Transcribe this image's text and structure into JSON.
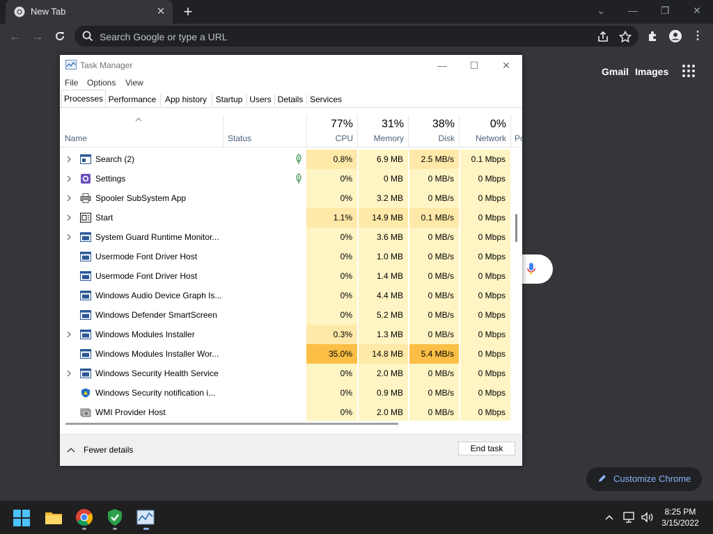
{
  "chrome": {
    "tab_title": "New Tab",
    "omnibox_placeholder": "Search Google or type a URL",
    "links": {
      "gmail": "Gmail",
      "images": "Images"
    },
    "customize_label": "Customize Chrome"
  },
  "taskmanager": {
    "title": "Task Manager",
    "menu": [
      "File",
      "Options",
      "View"
    ],
    "tabs": [
      "Processes",
      "Performance",
      "App history",
      "Startup",
      "Users",
      "Details",
      "Services"
    ],
    "active_tab": "Processes",
    "columns": {
      "name": "Name",
      "status": "Status",
      "cpu": {
        "pct": "77%",
        "label": "CPU"
      },
      "memory": {
        "pct": "31%",
        "label": "Memory"
      },
      "disk": {
        "pct": "38%",
        "label": "Disk"
      },
      "network": {
        "pct": "0%",
        "label": "Network"
      },
      "power_partial": "Po"
    },
    "rows": [
      {
        "name": "Search (2)",
        "expandable": true,
        "icon": "search-app-icon",
        "eco": true,
        "cpu": "0.8%",
        "memory": "6.9 MB",
        "disk": "2.5 MB/s",
        "network": "0.1 Mbps"
      },
      {
        "name": "Settings",
        "expandable": true,
        "icon": "settings-gear-icon",
        "eco": true,
        "cpu": "0%",
        "memory": "0 MB",
        "disk": "0 MB/s",
        "network": "0 Mbps"
      },
      {
        "name": "Spooler SubSystem App",
        "expandable": true,
        "icon": "printer-icon",
        "eco": false,
        "cpu": "0%",
        "memory": "3.2 MB",
        "disk": "0 MB/s",
        "network": "0 Mbps"
      },
      {
        "name": "Start",
        "expandable": true,
        "icon": "start-icon",
        "eco": false,
        "cpu": "1.1%",
        "memory": "14.9 MB",
        "disk": "0.1 MB/s",
        "network": "0 Mbps"
      },
      {
        "name": "System Guard Runtime Monitor...",
        "expandable": true,
        "icon": "process-window-icon",
        "eco": false,
        "cpu": "0%",
        "memory": "3.6 MB",
        "disk": "0 MB/s",
        "network": "0 Mbps"
      },
      {
        "name": "Usermode Font Driver Host",
        "expandable": false,
        "icon": "process-window-icon",
        "eco": false,
        "cpu": "0%",
        "memory": "1.0 MB",
        "disk": "0 MB/s",
        "network": "0 Mbps"
      },
      {
        "name": "Usermode Font Driver Host",
        "expandable": false,
        "icon": "process-window-icon",
        "eco": false,
        "cpu": "0%",
        "memory": "1.4 MB",
        "disk": "0 MB/s",
        "network": "0 Mbps"
      },
      {
        "name": "Windows Audio Device Graph Is...",
        "expandable": false,
        "icon": "process-window-icon",
        "eco": false,
        "cpu": "0%",
        "memory": "4.4 MB",
        "disk": "0 MB/s",
        "network": "0 Mbps"
      },
      {
        "name": "Windows Defender SmartScreen",
        "expandable": false,
        "icon": "process-window-icon",
        "eco": false,
        "cpu": "0%",
        "memory": "5.2 MB",
        "disk": "0 MB/s",
        "network": "0 Mbps"
      },
      {
        "name": "Windows Modules Installer",
        "expandable": true,
        "icon": "process-window-icon",
        "eco": false,
        "cpu": "0.3%",
        "memory": "1.3 MB",
        "disk": "0 MB/s",
        "network": "0 Mbps"
      },
      {
        "name": "Windows Modules Installer Wor...",
        "expandable": false,
        "icon": "process-window-icon",
        "eco": false,
        "cpu": "35.0%",
        "memory": "14.8 MB",
        "disk": "5.4 MB/s",
        "network": "0 Mbps"
      },
      {
        "name": "Windows Security Health Service",
        "expandable": true,
        "icon": "process-window-icon",
        "eco": false,
        "cpu": "0%",
        "memory": "2.0 MB",
        "disk": "0 MB/s",
        "network": "0 Mbps"
      },
      {
        "name": "Windows Security notification i...",
        "expandable": false,
        "icon": "security-shield-icon",
        "eco": false,
        "cpu": "0%",
        "memory": "0.9 MB",
        "disk": "0 MB/s",
        "network": "0 Mbps"
      },
      {
        "name": "WMI Provider Host",
        "expandable": false,
        "icon": "wmi-host-icon",
        "eco": false,
        "cpu": "0%",
        "memory": "2.0 MB",
        "disk": "0 MB/s",
        "network": "0 Mbps"
      }
    ],
    "footer": {
      "fewer_details": "Fewer details",
      "end_task": "End task"
    }
  },
  "heat_colors": {
    "light": "#fff4c4",
    "mid": "#ffe9a8",
    "strong": "#ffd27a",
    "hot": "#fbbf45"
  },
  "taskbar": {
    "clock_time": "8:25 PM",
    "clock_date": "3/15/2022"
  }
}
